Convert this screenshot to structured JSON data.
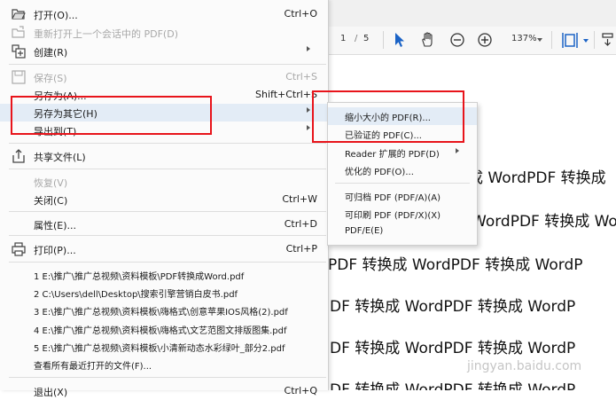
{
  "toolbar": {
    "page_current": "1",
    "page_separator": "/",
    "page_total": "5",
    "zoom": "137%"
  },
  "menu": {
    "open": {
      "label": "打开(O)...",
      "shortcut": "Ctrl+O"
    },
    "reopen": {
      "label": "重新打开上一个会话中的 PDF(D)"
    },
    "create": {
      "label": "创建(R)"
    },
    "save": {
      "label": "保存(S)",
      "shortcut": "Ctrl+S"
    },
    "save_as": {
      "label": "另存为(A)...",
      "shortcut": "Shift+Ctrl+S"
    },
    "save_as_other": {
      "label": "另存为其它(H)"
    },
    "export_to": {
      "label": "导出到(T)"
    },
    "share": {
      "label": "共享文件(L)"
    },
    "revert": {
      "label": "恢复(V)"
    },
    "close": {
      "label": "关闭(C)",
      "shortcut": "Ctrl+W"
    },
    "properties": {
      "label": "属性(E)...",
      "shortcut": "Ctrl+D"
    },
    "print": {
      "label": "打印(P)...",
      "shortcut": "Ctrl+P"
    },
    "recent_files": [
      "1 E:\\推广\\推广总视频\\资料模板\\PDF转换成Word.pdf",
      "2 C:\\Users\\dell\\Desktop\\搜索引擎营销白皮书.pdf",
      "3 E:\\推广\\推广总视频\\资料模板\\嗨格式\\创意苹果IOS风格(2).pdf",
      "4 E:\\推广\\推广总视频\\资料模板\\嗨格式\\文艺范图文排版图集.pdf",
      "5 E:\\推广\\推广总视频\\资料模板\\小清新动态水彩绿叶_部分2.pdf"
    ],
    "view_all_recent": "查看所有最近打开的文件(F)...",
    "exit": {
      "label": "退出(X)",
      "shortcut": "Ctrl+Q"
    }
  },
  "submenu": {
    "reduced_size": "缩小大小的 PDF(R)...",
    "certified": "已验证的 PDF(C)...",
    "reader_extended": "Reader 扩展的 PDF(D)",
    "optimized": "优化的 PDF(O)...",
    "archivable": "可归档 PDF (PDF/A)(A)",
    "printable": "可印刷 PDF (PDF/X)(X)",
    "pdf_e": "PDF/E(E)"
  },
  "document": {
    "line1": "成 WordPDF 转换成",
    "line2": "WordPDF 转换成 Wor",
    "line3": "PDF 转换成 WordPDF 转换成 WordP",
    "line4": "DF 转换成 WordPDF 转换成 WordP",
    "line5": "DF 转换成 WordPDF 转换成 WordP",
    "line6": "DF 转换成 WordPDF 转换成 WordP"
  },
  "watermark": "jingyan.baidu.com",
  "colors": {
    "annotation_red": "#e8141b",
    "highlight": "#e3ecf6",
    "toolbar_blue": "#1b63c6"
  }
}
